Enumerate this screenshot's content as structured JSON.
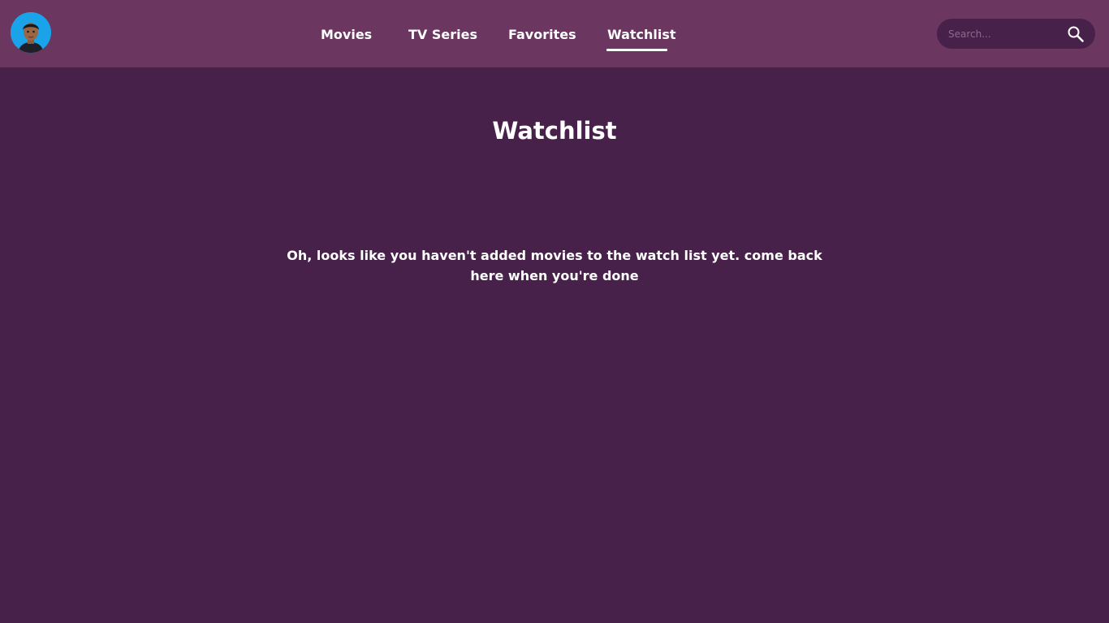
{
  "header": {
    "avatar_icon": "user-avatar-icon",
    "nav": [
      {
        "label": "Movies",
        "active": false
      },
      {
        "label": "TV Series",
        "active": false
      },
      {
        "label": "Favorites",
        "active": false
      },
      {
        "label": "Watchlist",
        "active": true
      }
    ],
    "search": {
      "placeholder": "Search...",
      "value": "",
      "icon": "search-icon"
    }
  },
  "main": {
    "title": "Watchlist",
    "empty_message": "Oh, looks like you haven't added movies to the watch list yet. come back here when you're done"
  },
  "colors": {
    "background": "#48214b",
    "navbar": "#6b365f",
    "avatar_bg": "#1aa3e8",
    "text": "#ffffff"
  }
}
